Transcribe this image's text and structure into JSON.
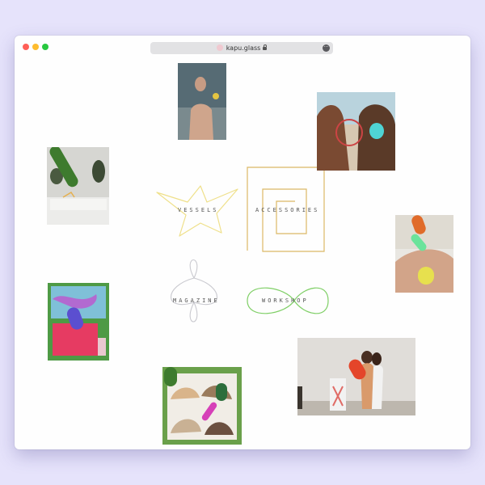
{
  "window": {
    "url": "kapu.glass"
  },
  "nav": {
    "vessels": "VESSELS",
    "accessories": "ACCESSORIES",
    "magazine": "MAGAZINE",
    "workshop": "WORKSHOP"
  },
  "colors": {
    "background": "#e6e3fb",
    "vessels_doodle": "#efe08a",
    "accessories_doodle": "#dcb966",
    "magazine_doodle": "#c9c9cf",
    "workshop_doodle": "#7fcf66",
    "blob_green": "#3e7b2e",
    "blob_teal": "#4fd4d4",
    "blob_orange": "#e06b2a",
    "blob_mint": "#6be39b",
    "blob_yellow": "#e7e04e",
    "blob_purple": "#5b4fd0",
    "blob_red": "#e4452a",
    "blob_magenta": "#d640b8"
  }
}
